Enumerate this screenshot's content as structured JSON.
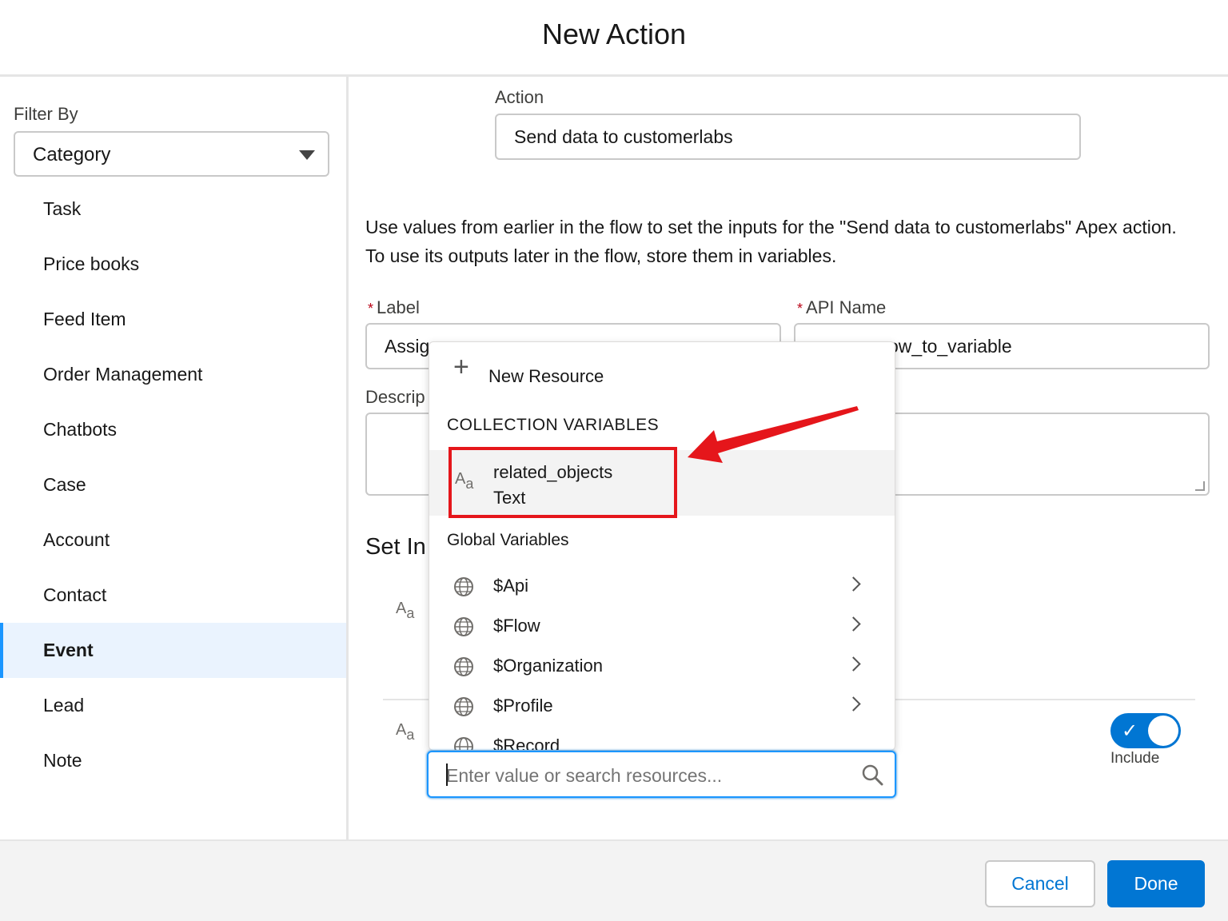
{
  "header": {
    "title": "New Action"
  },
  "sidebar": {
    "filter_label": "Filter By",
    "filter_select": "Category",
    "items": [
      "Task",
      "Price books",
      "Feed Item",
      "Order Management",
      "Chatbots",
      "Case",
      "Account",
      "Contact",
      "Event",
      "Lead",
      "Note"
    ],
    "active_item": "Event"
  },
  "main": {
    "action_label": "Action",
    "action_value": "Send data to customerlabs",
    "description_text": "Use values from earlier in the flow to set the inputs for the \"Send data to customerlabs\" Apex action. To use its outputs later in the flow, store them in variables.",
    "label_field": {
      "label": "Label",
      "value_visible": "Assig"
    },
    "api_name_field": {
      "label": "API Name",
      "value_visible": "ow_to_variable"
    },
    "description_field_label": "Descrip",
    "section_title": "Set In",
    "toggle_label": "Include",
    "toggle_on": true
  },
  "dropdown": {
    "new_resource": "New Resource",
    "collection_heading": "COLLECTION VARIABLES",
    "selected_variable": {
      "name": "related_objects",
      "type": "Text"
    },
    "global_heading": "Global Variables",
    "global_items": [
      "$Api",
      "$Flow",
      "$Organization",
      "$Profile",
      "$Record"
    ]
  },
  "search": {
    "placeholder": "Enter value or search resources..."
  },
  "footer": {
    "cancel_label": "Cancel",
    "done_label": "Done"
  },
  "colors": {
    "brand": "#0176d3",
    "highlight_box": "#e5161b",
    "active_bg": "#eaf3fe"
  }
}
